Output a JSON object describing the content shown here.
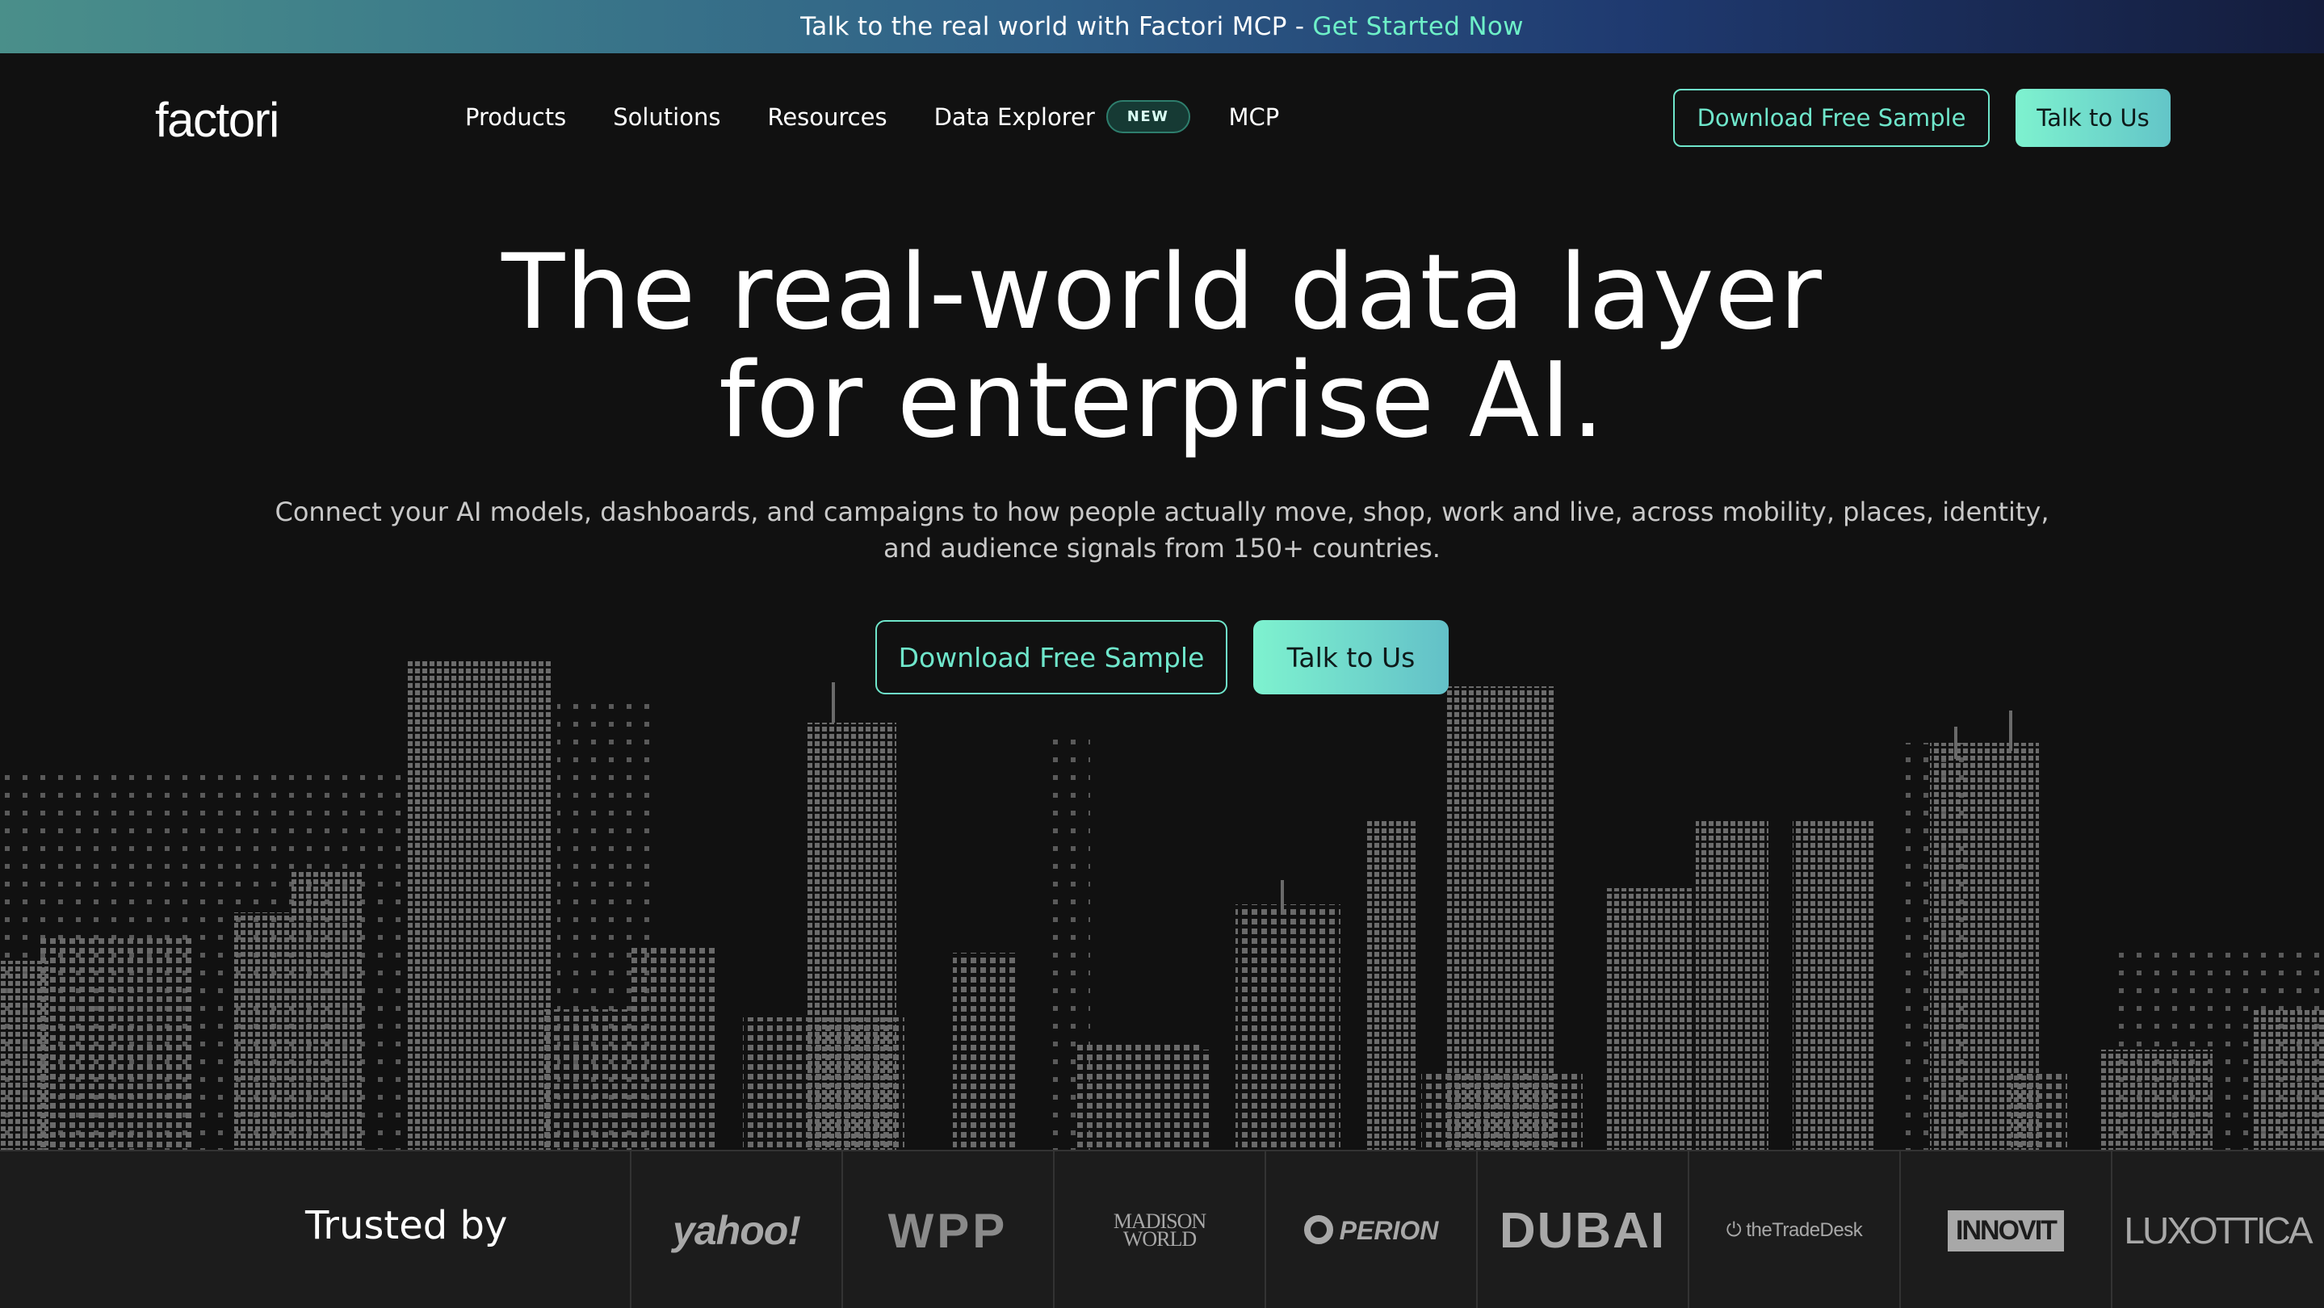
{
  "banner": {
    "text": "Talk to the real world with Factori MCP -",
    "cta": "Get Started Now"
  },
  "nav": {
    "logo": "factori",
    "links": [
      "Products",
      "Solutions",
      "Resources",
      "Data Explorer",
      "MCP"
    ],
    "new_badge": "NEW",
    "download_sample": "Download Free Sample",
    "talk_to_us": "Talk to Us"
  },
  "hero": {
    "title_line1": "The real-world data layer",
    "title_line2": "for enterprise AI.",
    "subtitle": "Connect your AI models, dashboards, and campaigns to how people actually move, shop, work and live, across mobility, places, identity, and audience signals from 150+ countries.",
    "download_sample": "Download Free Sample",
    "talk_to_us": "Talk to Us"
  },
  "trusted": {
    "label": "Trusted by",
    "logos": [
      {
        "name": "yahoo",
        "text": "yahoo!"
      },
      {
        "name": "wpp",
        "text": "WPP"
      },
      {
        "name": "madison-world",
        "text_line1": "MADISON",
        "text_line2": "WORLD"
      },
      {
        "name": "perion",
        "text": "PERION"
      },
      {
        "name": "dubai",
        "text": "DUBAI"
      },
      {
        "name": "the-trade-desk",
        "text": "theTradeDesk"
      },
      {
        "name": "innovit",
        "text": "INNOVIT"
      },
      {
        "name": "luxottica",
        "text": "LUXOTTICA"
      }
    ]
  },
  "colors": {
    "accent": "#6fe6cb",
    "background": "#111111",
    "skyline": "#6a6a6a"
  }
}
